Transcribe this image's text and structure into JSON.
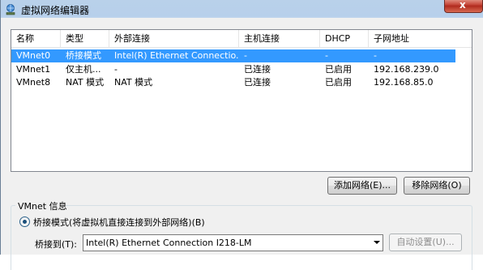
{
  "window": {
    "title": "虚拟网络编辑器",
    "close_label": "x"
  },
  "table": {
    "columns": [
      "名称",
      "类型",
      "外部连接",
      "主机连接",
      "DHCP",
      "子网地址"
    ],
    "rows": [
      [
        "VMnet0",
        "桥接模式",
        "Intel(R) Ethernet Connectio...",
        "-",
        "-",
        "-"
      ],
      [
        "VMnet1",
        "仅主机...",
        "-",
        "已连接",
        "已启用",
        "192.168.239.0"
      ],
      [
        "VMnet8",
        "NAT 模式",
        "NAT 模式",
        "已连接",
        "已启用",
        "192.168.85.0"
      ]
    ],
    "selected_row": 0
  },
  "buttons": {
    "add_network": "添加网络(E)...",
    "remove_network": "移除网络(O)",
    "auto_settings": "自动设置(U)..."
  },
  "vmnet_info": {
    "group_label": "VMnet 信息",
    "bridged_mode_label": "桥接模式(将虚拟机直接连接到外部网络)(B)",
    "bridge_to_label": "桥接到(T):",
    "bridge_to_value": "Intel(R) Ethernet Connection I218-LM"
  },
  "colors": {
    "selection": "#3399ff",
    "title_bar": "#b9d1ea",
    "close_button": "#c6483a"
  },
  "icons": {
    "title": "network-globe-icon",
    "dropdown": "chevron-down-icon"
  }
}
